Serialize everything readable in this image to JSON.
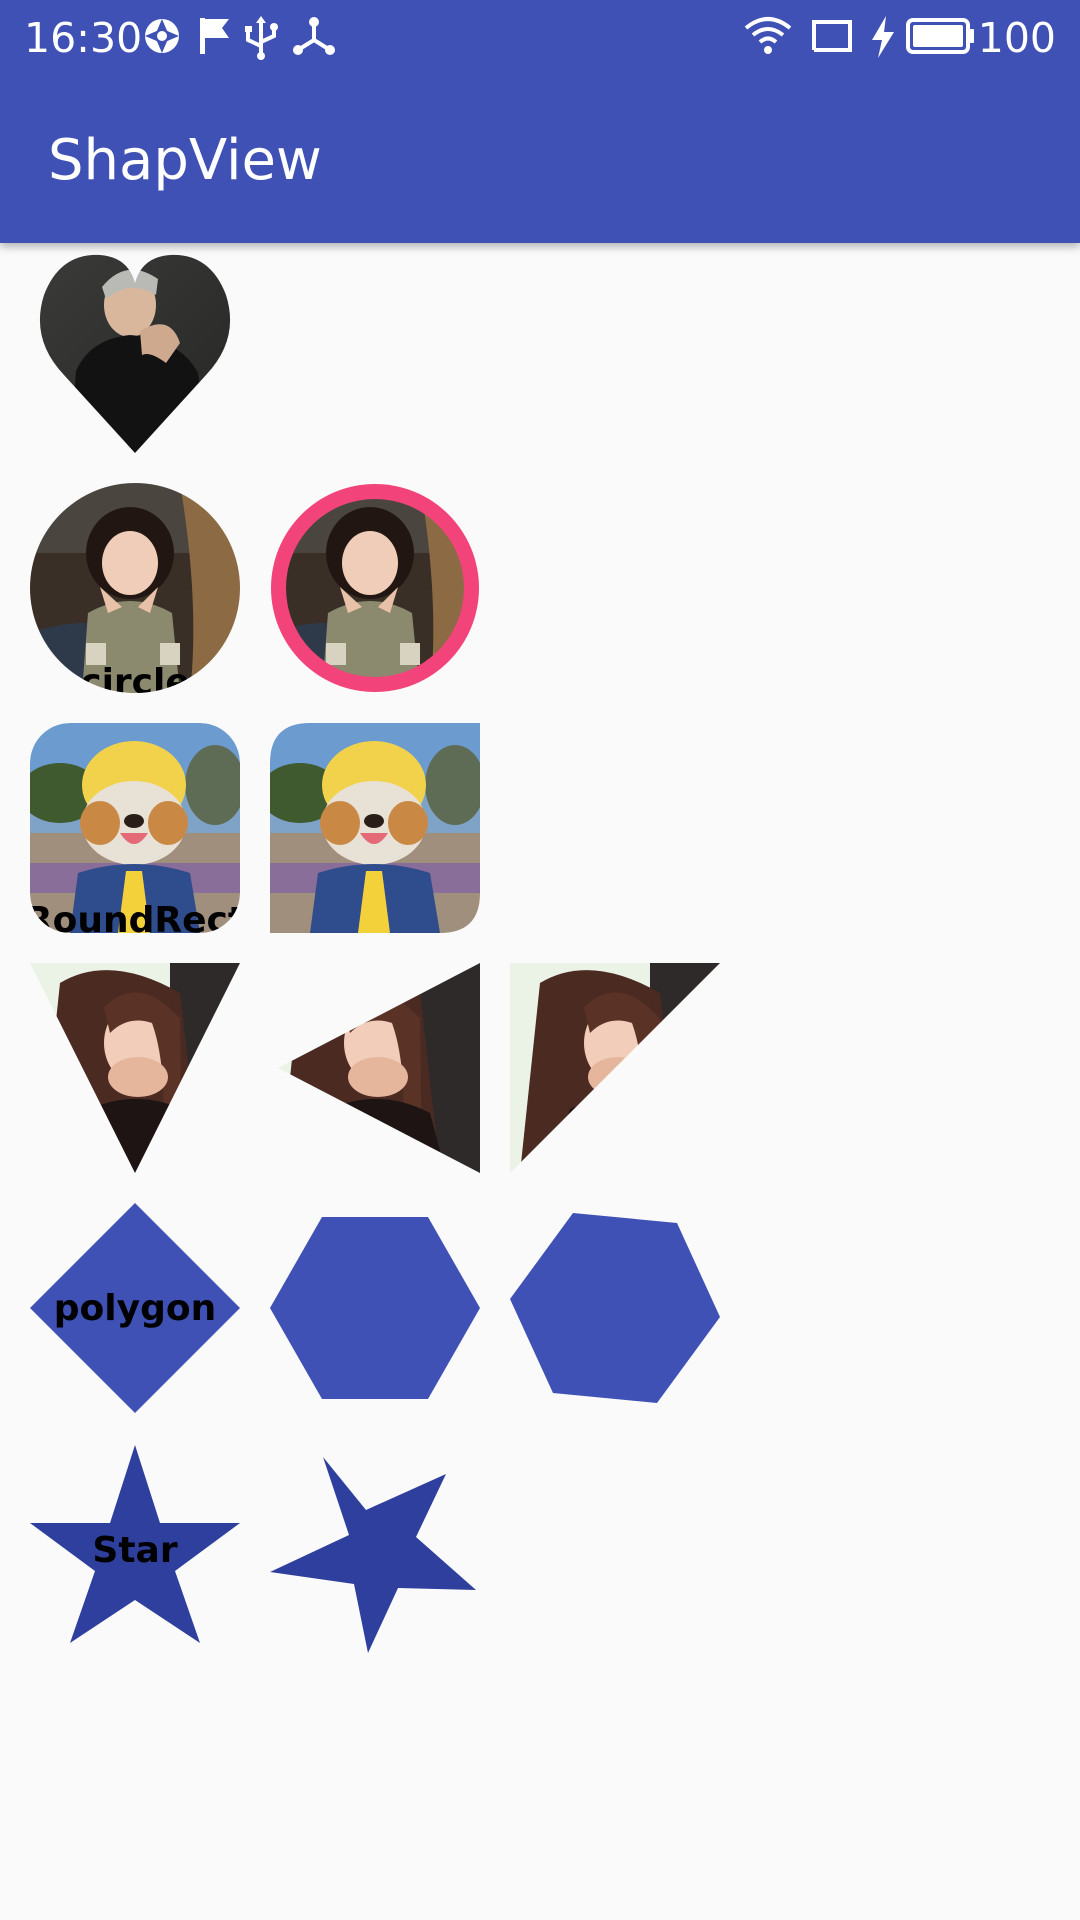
{
  "status_bar": {
    "time": "16:30",
    "battery_percent": "100",
    "left_icons": [
      "aperture-icon",
      "flag-icon",
      "usb-icon",
      "share-hub-icon"
    ],
    "right_icons": [
      "wifi-icon",
      "cast-icon",
      "charging-bolt-icon",
      "battery-icon"
    ]
  },
  "app_bar": {
    "title": "ShapView",
    "color": "#3F51B5"
  },
  "colors": {
    "shape_fill": "#3F51B5",
    "star_fill_dark": "#2E3F9E",
    "border_pink": "#F2447A",
    "background": "#FAFAFA"
  },
  "rows": [
    {
      "name": "heart",
      "items": [
        {
          "shape": "heart",
          "image": "man-portrait"
        }
      ]
    },
    {
      "name": "circle",
      "items": [
        {
          "shape": "circle",
          "image": "girl-photo",
          "label": "circle"
        },
        {
          "shape": "circle-bordered",
          "image": "girl-photo"
        }
      ]
    },
    {
      "name": "round-rect",
      "items": [
        {
          "shape": "round-rect",
          "image": "dog-photo",
          "label": "RoundRect"
        },
        {
          "shape": "round-rect-partial",
          "image": "dog-photo"
        }
      ]
    },
    {
      "name": "triangle",
      "items": [
        {
          "shape": "triangle-down",
          "image": "woman-photo"
        },
        {
          "shape": "triangle-left",
          "image": "woman-photo"
        },
        {
          "shape": "triangle-diagonal",
          "image": "woman-photo"
        }
      ]
    },
    {
      "name": "polygon",
      "items": [
        {
          "shape": "diamond",
          "label": "polygon"
        },
        {
          "shape": "hexagon"
        },
        {
          "shape": "hexagon-rotated"
        }
      ]
    },
    {
      "name": "star",
      "items": [
        {
          "shape": "star",
          "label": "Star"
        },
        {
          "shape": "star-rotated"
        }
      ]
    }
  ]
}
